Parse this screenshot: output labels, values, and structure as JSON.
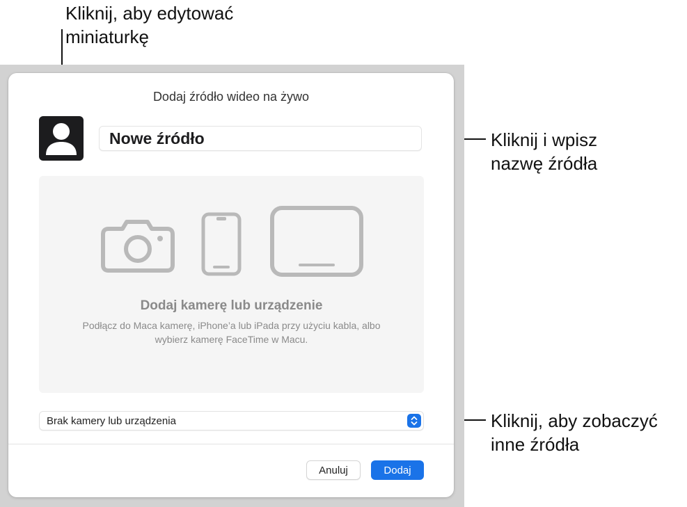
{
  "callouts": {
    "thumbnail": "Kliknij, aby edytować miniaturkę",
    "name": "Kliknij i wpisz nazwę źródła",
    "sources": "Kliknij, aby zobaczyć inne źródła"
  },
  "dialog": {
    "title": "Dodaj źródło wideo na żywo",
    "name_value": "Nowe źródło",
    "drop_title": "Dodaj kamerę lub urządzenie",
    "drop_description": "Podłącz do Maca kamerę, iPhone’a lub iPada przy użyciu kabla, albo wybierz kamerę FaceTime w Macu.",
    "source_selected": "Brak kamery lub urządzenia",
    "cancel_label": "Anuluj",
    "add_label": "Dodaj"
  },
  "icons": {
    "thumbnail": "person-silhouette-icon",
    "camera": "camera-icon",
    "iphone": "iphone-icon",
    "ipad": "ipad-icon",
    "stepper": "chevron-up-down-icon"
  },
  "colors": {
    "accent": "#1a73e8",
    "thumbnail_bg": "#1c1c1e",
    "placeholder_icon": "#b9b9b9"
  }
}
